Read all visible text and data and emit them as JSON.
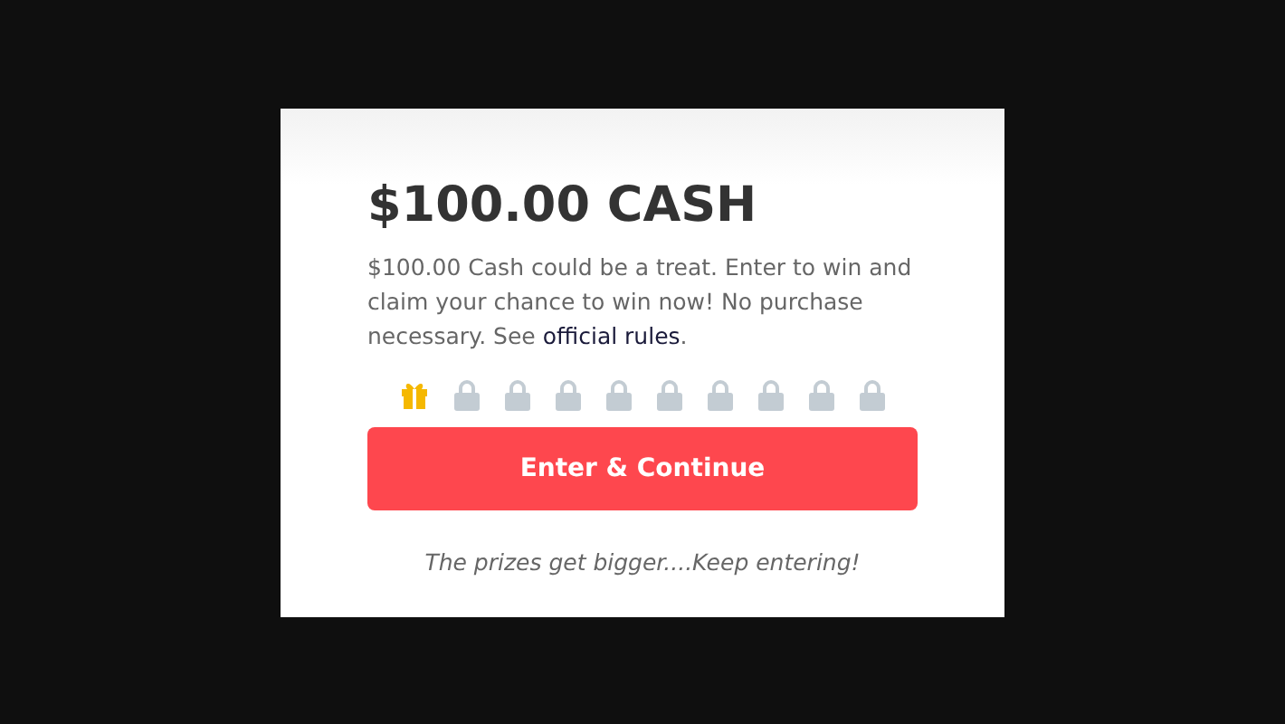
{
  "card": {
    "title": "$100.00 CASH",
    "description": "$100.00 Cash could be a treat. Enter to win and claim your chance to win now! No purchase necessary. See ",
    "rules_link": "official rules",
    "description_end": ".",
    "steps": [
      {
        "unlocked": true
      },
      {
        "unlocked": false
      },
      {
        "unlocked": false
      },
      {
        "unlocked": false
      },
      {
        "unlocked": false
      },
      {
        "unlocked": false
      },
      {
        "unlocked": false
      },
      {
        "unlocked": false
      },
      {
        "unlocked": false
      },
      {
        "unlocked": false
      }
    ],
    "button": "Enter & Continue",
    "footer": "The prizes get bigger....Keep entering!"
  }
}
